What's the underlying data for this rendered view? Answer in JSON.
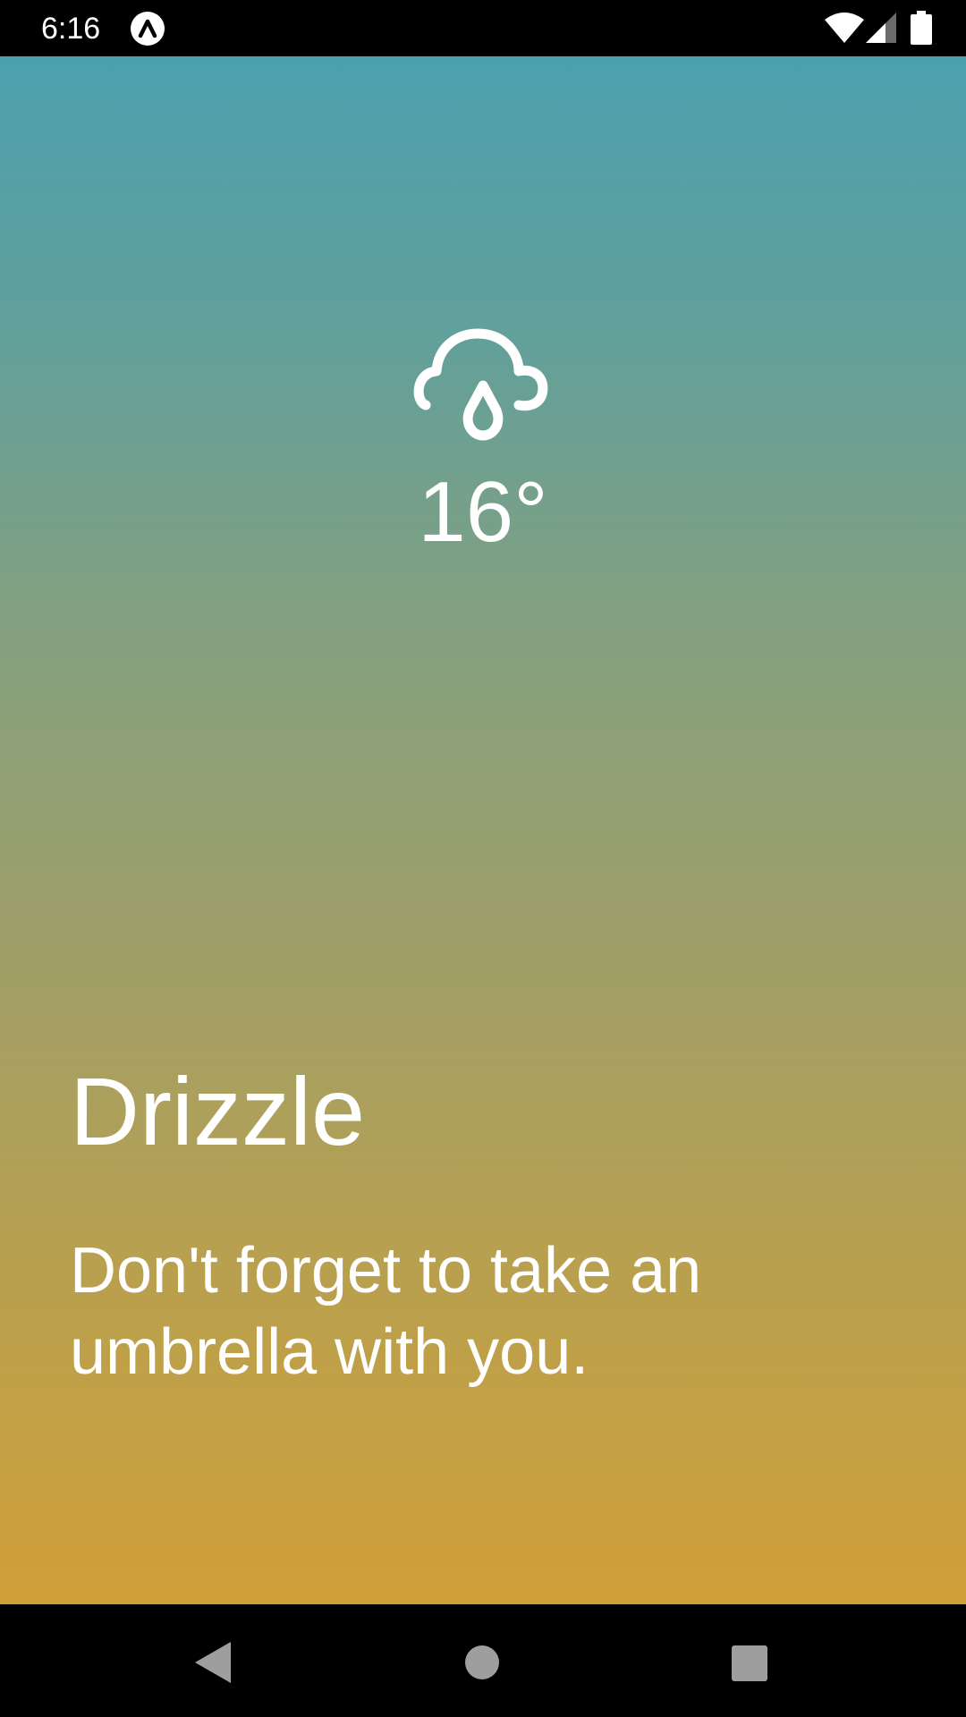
{
  "status_bar": {
    "time": "6:16",
    "icons": [
      "expo-badge-icon",
      "wifi-icon",
      "cellular-signal-icon",
      "battery-icon"
    ]
  },
  "weather": {
    "icon": "cloud-drizzle-icon",
    "temperature": "16°",
    "condition": "Drizzle",
    "message": "Don't forget to take an umbrella with you."
  },
  "colors": {
    "gradient_top": "#4ca0ae",
    "gradient_bottom": "#d09f38",
    "text": "#ffffff",
    "system_bars": "#000000"
  },
  "nav_bar": {
    "buttons": [
      "back-icon",
      "home-icon",
      "recents-icon"
    ]
  }
}
